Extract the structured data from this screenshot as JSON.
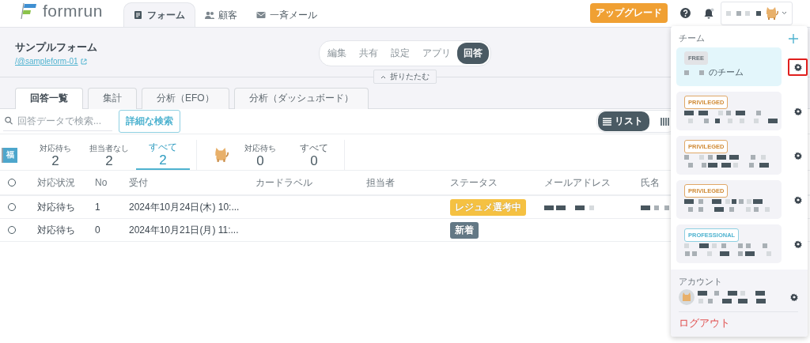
{
  "brand": {
    "name": "formrun"
  },
  "nav": [
    {
      "label": "フォーム",
      "selected": true
    },
    {
      "label": "顧客",
      "selected": false
    },
    {
      "label": "一斉メール",
      "selected": false
    }
  ],
  "upgrade_button": "アップグレード",
  "form": {
    "title": "サンプルフォーム",
    "link": "/@sampleform-01"
  },
  "mode_tabs": [
    {
      "label": "編集",
      "selected": false
    },
    {
      "label": "共有",
      "selected": false
    },
    {
      "label": "設定",
      "selected": false
    },
    {
      "label": "アプリ",
      "selected": false
    },
    {
      "label": "回答",
      "selected": true
    }
  ],
  "collapse_button": "折りたたむ",
  "view_tabs": [
    {
      "label": "回答一覧",
      "selected": true
    },
    {
      "label": "集計",
      "selected": false
    },
    {
      "label": "分析（EFO）",
      "selected": false
    },
    {
      "label": "分析（ダッシュボード）",
      "selected": false
    }
  ],
  "search": {
    "placeholder": "回答データで検索..."
  },
  "advanced_search_button": "詳細な検索",
  "view_switch": [
    {
      "label": "リスト",
      "selected": true
    },
    {
      "selected": false
    }
  ],
  "counter_groups": [
    {
      "kind": "letter",
      "avatar": "福",
      "counters": [
        {
          "label": "対応待ち",
          "count": "2",
          "selected": false
        },
        {
          "label": "担当者なし",
          "count": "2",
          "selected": false
        },
        {
          "label": "すべて",
          "count": "2",
          "selected": true
        }
      ]
    },
    {
      "kind": "cat",
      "counters": [
        {
          "label": "対応待ち",
          "count": "0",
          "selected": false
        },
        {
          "label": "すべて",
          "count": "0",
          "selected": false
        }
      ]
    }
  ],
  "table": {
    "all_selected": false,
    "columns": [
      "対応状況",
      "No",
      "受付",
      "カードラベル",
      "担当者",
      "ステータス",
      "メールアドレス",
      "氏名"
    ],
    "rows": [
      {
        "selected": false,
        "state": "対応待ち",
        "no": "1",
        "received": "2024年10月24日(木) 10:...",
        "status": {
          "label": "レジュメ選考中",
          "color": "#f5c142"
        },
        "email_redacted": true,
        "name_redacted": true
      },
      {
        "selected": false,
        "state": "対応待ち",
        "no": "0",
        "received": "2024年10月21日(月) 11:...",
        "status": {
          "label": "新着",
          "color": "#637885"
        },
        "email_redacted": false,
        "name_redacted": false
      }
    ]
  },
  "team_menu": {
    "title": "チーム",
    "teams": [
      {
        "plan": "FREE",
        "kind": "free",
        "name": "のチーム",
        "selected": true,
        "highlighted": true
      },
      {
        "plan": "PRIVILEGED",
        "kind": "privileged",
        "selected": false,
        "highlighted": false
      },
      {
        "plan": "PRIVILEGED",
        "kind": "privileged",
        "selected": false,
        "highlighted": false
      },
      {
        "plan": "PRIVILEGED",
        "kind": "privileged",
        "selected": false,
        "highlighted": false
      },
      {
        "plan": "PROFESSIONAL",
        "kind": "professional",
        "selected": false,
        "highlighted": false
      }
    ],
    "account_title": "アカウント",
    "logout": "ログアウト"
  }
}
